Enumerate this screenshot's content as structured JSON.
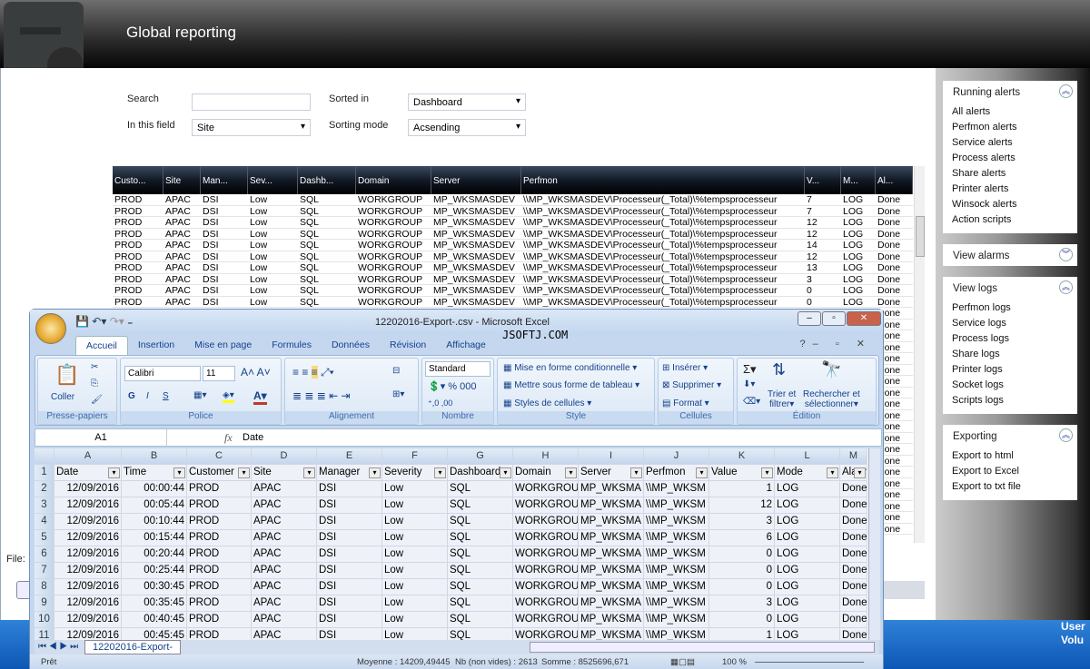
{
  "header": {
    "title": "Global reporting"
  },
  "filters": {
    "search_label": "Search",
    "search_value": "",
    "field_label": "In this field",
    "field_value": "Site",
    "sorted_label": "Sorted in",
    "sorted_value": "Dashboard",
    "mode_label": "Sorting mode",
    "mode_value": "Acsending"
  },
  "table": {
    "columns": [
      "Custo...",
      "Site",
      "Man...",
      "Sev...",
      "Dashb...",
      "Domain",
      "Server",
      "Perfmon",
      "V...",
      "M...",
      "Al..."
    ],
    "rows": [
      [
        "PROD",
        "APAC",
        "DSI",
        "Low",
        "SQL",
        "WORKGROUP",
        "MP_WKSMASDEV",
        "\\\\MP_WKSMASDEV\\Processeur(_Total)\\%tempsprocesseur",
        "7",
        "LOG",
        "Done"
      ],
      [
        "PROD",
        "APAC",
        "DSI",
        "Low",
        "SQL",
        "WORKGROUP",
        "MP_WKSMASDEV",
        "\\\\MP_WKSMASDEV\\Processeur(_Total)\\%tempsprocesseur",
        "7",
        "LOG",
        "Done"
      ],
      [
        "PROD",
        "APAC",
        "DSI",
        "Low",
        "SQL",
        "WORKGROUP",
        "MP_WKSMASDEV",
        "\\\\MP_WKSMASDEV\\Processeur(_Total)\\%tempsprocesseur",
        "12",
        "LOG",
        "Done"
      ],
      [
        "PROD",
        "APAC",
        "DSI",
        "Low",
        "SQL",
        "WORKGROUP",
        "MP_WKSMASDEV",
        "\\\\MP_WKSMASDEV\\Processeur(_Total)\\%tempsprocesseur",
        "12",
        "LOG",
        "Done"
      ],
      [
        "PROD",
        "APAC",
        "DSI",
        "Low",
        "SQL",
        "WORKGROUP",
        "MP_WKSMASDEV",
        "\\\\MP_WKSMASDEV\\Processeur(_Total)\\%tempsprocesseur",
        "14",
        "LOG",
        "Done"
      ],
      [
        "PROD",
        "APAC",
        "DSI",
        "Low",
        "SQL",
        "WORKGROUP",
        "MP_WKSMASDEV",
        "\\\\MP_WKSMASDEV\\Processeur(_Total)\\%tempsprocesseur",
        "12",
        "LOG",
        "Done"
      ],
      [
        "PROD",
        "APAC",
        "DSI",
        "Low",
        "SQL",
        "WORKGROUP",
        "MP_WKSMASDEV",
        "\\\\MP_WKSMASDEV\\Processeur(_Total)\\%tempsprocesseur",
        "13",
        "LOG",
        "Done"
      ],
      [
        "PROD",
        "APAC",
        "DSI",
        "Low",
        "SQL",
        "WORKGROUP",
        "MP_WKSMASDEV",
        "\\\\MP_WKSMASDEV\\Processeur(_Total)\\%tempsprocesseur",
        "3",
        "LOG",
        "Done"
      ],
      [
        "PROD",
        "APAC",
        "DSI",
        "Low",
        "SQL",
        "WORKGROUP",
        "MP_WKSMASDEV",
        "\\\\MP_WKSMASDEV\\Processeur(_Total)\\%tempsprocesseur",
        "0",
        "LOG",
        "Done"
      ],
      [
        "PROD",
        "APAC",
        "DSI",
        "Low",
        "SQL",
        "WORKGROUP",
        "MP_WKSMASDEV",
        "\\\\MP_WKSMASDEV\\Processeur(_Total)\\%tempsprocesseur",
        "0",
        "LOG",
        "Done"
      ]
    ],
    "hidden_rows_alarm": [
      "Done",
      "Done",
      "Done",
      "Done",
      "Done",
      "Done",
      "Done",
      "Done",
      "Done",
      "Done",
      "Done",
      "Done",
      "Done",
      "Done",
      "Done",
      "Done",
      "Done",
      "Done",
      "Done",
      "Done"
    ]
  },
  "sidebar": [
    {
      "title": "Running alerts",
      "expanded": true,
      "items": [
        "All alerts",
        "Perfmon alerts",
        "Service alerts",
        "Process alerts",
        "Share alerts",
        "Printer alerts",
        "Winsock alerts",
        "Action scripts"
      ]
    },
    {
      "title": "View alarms",
      "expanded": false,
      "items": []
    },
    {
      "title": "View logs",
      "expanded": true,
      "items": [
        "Perfmon logs",
        "Service logs",
        "Process logs",
        "Share logs",
        "Printer logs",
        "Socket logs",
        "Scripts logs"
      ]
    },
    {
      "title": "Exporting",
      "expanded": true,
      "items": [
        "Export to html",
        "Export to Excel",
        "Export to txt file"
      ]
    }
  ],
  "bottom": {
    "file_label": "File:",
    "taskbar_text1": "User",
    "taskbar_text2": "Volu"
  },
  "excel": {
    "title": "12202016-Export-.csv - Microsoft Excel",
    "watermark": "JSOFTJ.COM",
    "tabs": [
      "Accueil",
      "Insertion",
      "Mise en page",
      "Formules",
      "Données",
      "Révision",
      "Affichage"
    ],
    "ribbon": {
      "paste": "Coller",
      "clipboard": "Presse-papiers",
      "font_name": "Calibri",
      "font_size": "11",
      "font_group": "Police",
      "bold": "G",
      "italic": "I",
      "underline": "S",
      "align_group": "Alignement",
      "number_format": "Standard",
      "number_group": "Nombre",
      "cond_format": "Mise en forme conditionnelle",
      "as_table": "Mettre sous forme de tableau",
      "cell_styles": "Styles de cellules",
      "style_group": "Style",
      "insert": "Insérer",
      "delete": "Supprimer",
      "format": "Format",
      "cells_group": "Cellules",
      "sort": "Trier et",
      "sort2": "filtrer",
      "find": "Rechercher et",
      "find2": "sélectionner",
      "edit_group": "Édition"
    },
    "name_box": "A1",
    "formula": "Date",
    "col_letters": [
      "A",
      "B",
      "C",
      "D",
      "E",
      "F",
      "G",
      "H",
      "I",
      "J",
      "K",
      "L",
      "M"
    ],
    "headers": [
      "Date",
      "Time",
      "Customer",
      "Site",
      "Manager",
      "Severity",
      "Dashboard",
      "Domain",
      "Server",
      "Perfmon",
      "Value",
      "Mode",
      "Alarm"
    ],
    "rows": [
      [
        "12/09/2016",
        "00:00:44",
        "PROD",
        "APAC",
        "DSI",
        "Low",
        "SQL",
        "WORKGROUP",
        "MP_WKSMA",
        "\\\\MP_WKSM",
        "1",
        "LOG",
        "Done"
      ],
      [
        "12/09/2016",
        "00:05:44",
        "PROD",
        "APAC",
        "DSI",
        "Low",
        "SQL",
        "WORKGROUP",
        "MP_WKSMA",
        "\\\\MP_WKSM",
        "12",
        "LOG",
        "Done"
      ],
      [
        "12/09/2016",
        "00:10:44",
        "PROD",
        "APAC",
        "DSI",
        "Low",
        "SQL",
        "WORKGROUP",
        "MP_WKSMA",
        "\\\\MP_WKSM",
        "3",
        "LOG",
        "Done"
      ],
      [
        "12/09/2016",
        "00:15:44",
        "PROD",
        "APAC",
        "DSI",
        "Low",
        "SQL",
        "WORKGROUP",
        "MP_WKSMA",
        "\\\\MP_WKSM",
        "6",
        "LOG",
        "Done"
      ],
      [
        "12/09/2016",
        "00:20:44",
        "PROD",
        "APAC",
        "DSI",
        "Low",
        "SQL",
        "WORKGROUP",
        "MP_WKSMA",
        "\\\\MP_WKSM",
        "0",
        "LOG",
        "Done"
      ],
      [
        "12/09/2016",
        "00:25:44",
        "PROD",
        "APAC",
        "DSI",
        "Low",
        "SQL",
        "WORKGROUP",
        "MP_WKSMA",
        "\\\\MP_WKSM",
        "0",
        "LOG",
        "Done"
      ],
      [
        "12/09/2016",
        "00:30:45",
        "PROD",
        "APAC",
        "DSI",
        "Low",
        "SQL",
        "WORKGROUP",
        "MP_WKSMA",
        "\\\\MP_WKSM",
        "0",
        "LOG",
        "Done"
      ],
      [
        "12/09/2016",
        "00:35:45",
        "PROD",
        "APAC",
        "DSI",
        "Low",
        "SQL",
        "WORKGROUP",
        "MP_WKSMA",
        "\\\\MP_WKSM",
        "3",
        "LOG",
        "Done"
      ],
      [
        "12/09/2016",
        "00:40:45",
        "PROD",
        "APAC",
        "DSI",
        "Low",
        "SQL",
        "WORKGROUP",
        "MP_WKSMA",
        "\\\\MP_WKSM",
        "0",
        "LOG",
        "Done"
      ],
      [
        "12/09/2016",
        "00:45:45",
        "PROD",
        "APAC",
        "DSI",
        "Low",
        "SQL",
        "WORKGROUP",
        "MP_WKSMA",
        "\\\\MP_WKSM",
        "1",
        "LOG",
        "Done"
      ]
    ],
    "sheet_tab": "12202016-Export-",
    "status": {
      "ready": "Prêt",
      "average": "Moyenne : 14209,49445",
      "count": "Nb (non vides) : 2613",
      "sum": "Somme : 8525696,671",
      "zoom": "100 %"
    }
  }
}
